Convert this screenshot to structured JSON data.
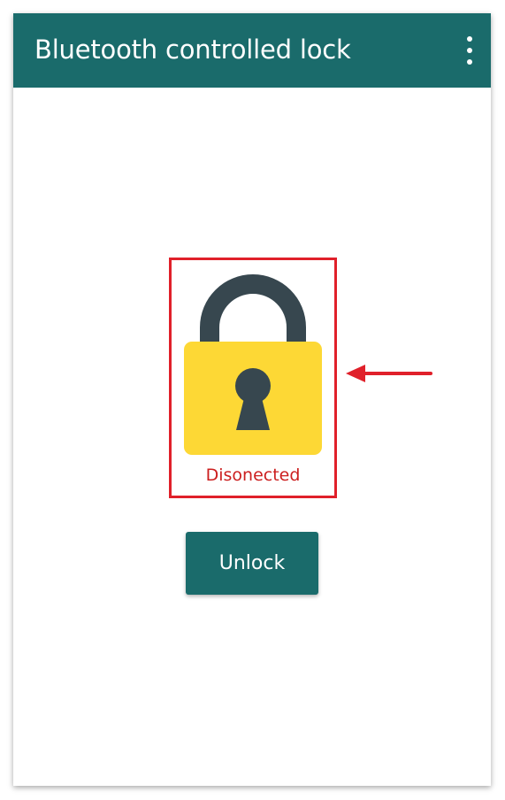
{
  "app_bar": {
    "title": "Bluetooth controlled lock",
    "menu_icon": "more-vert-icon",
    "background_color": "#1a6b6b"
  },
  "lock": {
    "icon": "padlock-icon",
    "shackle_color": "#37474f",
    "body_color": "#fdd835",
    "keyhole_color": "#37474f",
    "status_text": "Disonected",
    "status_color": "#cc1f1f"
  },
  "annotation": {
    "frame_color": "#e0202a",
    "arrow_icon": "arrow-left-icon"
  },
  "actions": {
    "unlock_label": "Unlock"
  }
}
